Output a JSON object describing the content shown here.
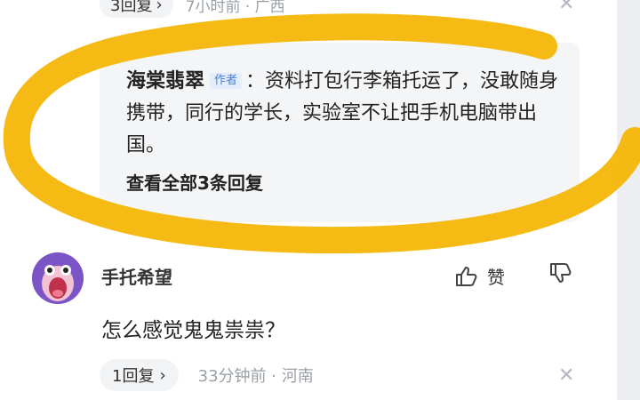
{
  "top_row": {
    "reply_count": "3回复",
    "chevron": "chevron-right-icon",
    "meta": "7小时前 · 广西",
    "close_icon": "close-icon"
  },
  "reply": {
    "author": "海棠翡翠",
    "badge": "作者",
    "content": "：资料打包行李箱托运了，没敢随身携带，同行的学长，实验室不让把手机电脑带出国。",
    "view_all": "查看全部3条回复"
  },
  "comment": {
    "username": "手托希望",
    "like_label": "赞",
    "like_icon": "thumbs-up-icon",
    "dislike_icon": "thumbs-down-icon",
    "text": "怎么感觉鬼鬼祟祟？",
    "reply_count": "1回复",
    "meta": "33分钟前 · 河南",
    "close_icon": "close-icon"
  },
  "colors": {
    "highlight": "#f4b400",
    "badge": "#4a7fd8",
    "avatar": "#7b55c6"
  }
}
